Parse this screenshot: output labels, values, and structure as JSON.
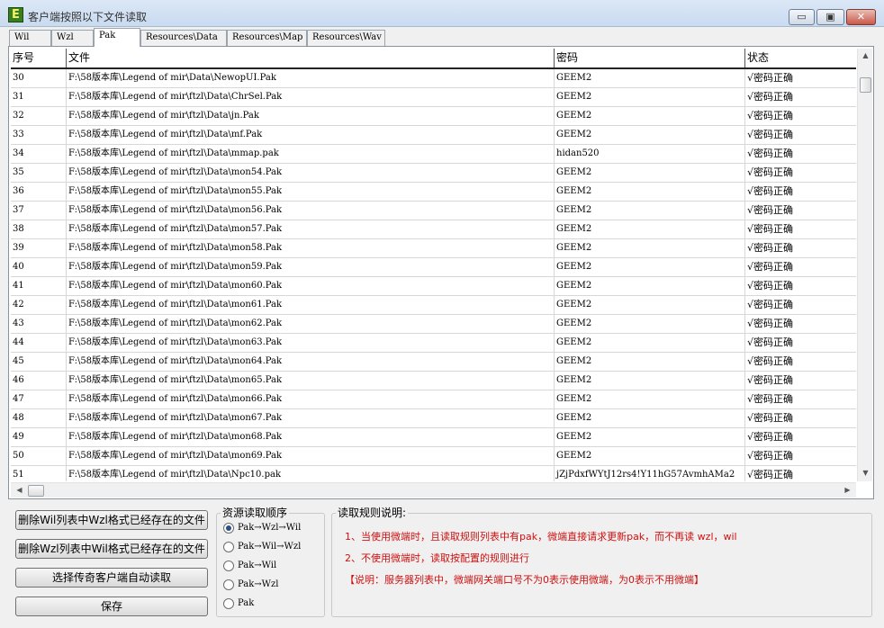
{
  "window": {
    "app_icon_letter": "E",
    "title": "客户端按照以下文件读取",
    "min_label": "▭",
    "max_label": "▣",
    "close_label": "✕"
  },
  "tabs": [
    {
      "label": "Wil",
      "active": false
    },
    {
      "label": "Wzl",
      "active": false
    },
    {
      "label": "Pak",
      "active": true
    },
    {
      "label": "Resources\\Data",
      "active": false
    },
    {
      "label": "Resources\\Map",
      "active": false
    },
    {
      "label": "Resources\\Wav",
      "active": false
    }
  ],
  "table": {
    "columns": [
      "序号",
      "文件",
      "密码",
      "状态"
    ],
    "rows": [
      {
        "no": "30",
        "file": "F:\\58版本库\\Legend of mir\\Data\\NewopUI.Pak",
        "pwd": "GEEM2",
        "status": "√密码正确"
      },
      {
        "no": "31",
        "file": "F:\\58版本库\\Legend of mir\\ftzl\\Data\\ChrSel.Pak",
        "pwd": "GEEM2",
        "status": "√密码正确"
      },
      {
        "no": "32",
        "file": "F:\\58版本库\\Legend of mir\\ftzl\\Data\\jn.Pak",
        "pwd": "GEEM2",
        "status": "√密码正确"
      },
      {
        "no": "33",
        "file": "F:\\58版本库\\Legend of mir\\ftzl\\Data\\mf.Pak",
        "pwd": "GEEM2",
        "status": "√密码正确"
      },
      {
        "no": "34",
        "file": "F:\\58版本库\\Legend of mir\\ftzl\\Data\\mmap.pak",
        "pwd": "hidan520",
        "status": "√密码正确"
      },
      {
        "no": "35",
        "file": "F:\\58版本库\\Legend of mir\\ftzl\\Data\\mon54.Pak",
        "pwd": "GEEM2",
        "status": "√密码正确"
      },
      {
        "no": "36",
        "file": "F:\\58版本库\\Legend of mir\\ftzl\\Data\\mon55.Pak",
        "pwd": "GEEM2",
        "status": "√密码正确"
      },
      {
        "no": "37",
        "file": "F:\\58版本库\\Legend of mir\\ftzl\\Data\\mon56.Pak",
        "pwd": "GEEM2",
        "status": "√密码正确"
      },
      {
        "no": "38",
        "file": "F:\\58版本库\\Legend of mir\\ftzl\\Data\\mon57.Pak",
        "pwd": "GEEM2",
        "status": "√密码正确"
      },
      {
        "no": "39",
        "file": "F:\\58版本库\\Legend of mir\\ftzl\\Data\\mon58.Pak",
        "pwd": "GEEM2",
        "status": "√密码正确"
      },
      {
        "no": "40",
        "file": "F:\\58版本库\\Legend of mir\\ftzl\\Data\\mon59.Pak",
        "pwd": "GEEM2",
        "status": "√密码正确"
      },
      {
        "no": "41",
        "file": "F:\\58版本库\\Legend of mir\\ftzl\\Data\\mon60.Pak",
        "pwd": "GEEM2",
        "status": "√密码正确"
      },
      {
        "no": "42",
        "file": "F:\\58版本库\\Legend of mir\\ftzl\\Data\\mon61.Pak",
        "pwd": "GEEM2",
        "status": "√密码正确"
      },
      {
        "no": "43",
        "file": "F:\\58版本库\\Legend of mir\\ftzl\\Data\\mon62.Pak",
        "pwd": "GEEM2",
        "status": "√密码正确"
      },
      {
        "no": "44",
        "file": "F:\\58版本库\\Legend of mir\\ftzl\\Data\\mon63.Pak",
        "pwd": "GEEM2",
        "status": "√密码正确"
      },
      {
        "no": "45",
        "file": "F:\\58版本库\\Legend of mir\\ftzl\\Data\\mon64.Pak",
        "pwd": "GEEM2",
        "status": "√密码正确"
      },
      {
        "no": "46",
        "file": "F:\\58版本库\\Legend of mir\\ftzl\\Data\\mon65.Pak",
        "pwd": "GEEM2",
        "status": "√密码正确"
      },
      {
        "no": "47",
        "file": "F:\\58版本库\\Legend of mir\\ftzl\\Data\\mon66.Pak",
        "pwd": "GEEM2",
        "status": "√密码正确"
      },
      {
        "no": "48",
        "file": "F:\\58版本库\\Legend of mir\\ftzl\\Data\\mon67.Pak",
        "pwd": "GEEM2",
        "status": "√密码正确"
      },
      {
        "no": "49",
        "file": "F:\\58版本库\\Legend of mir\\ftzl\\Data\\mon68.Pak",
        "pwd": "GEEM2",
        "status": "√密码正确"
      },
      {
        "no": "50",
        "file": "F:\\58版本库\\Legend of mir\\ftzl\\Data\\mon69.Pak",
        "pwd": "GEEM2",
        "status": "√密码正确"
      },
      {
        "no": "51",
        "file": "F:\\58版本库\\Legend of mir\\ftzl\\Data\\Npc10.pak",
        "pwd": "jZjPdxfWYtJ12rs4!Y11hG57AvmhAMa2",
        "status": "√密码正确"
      }
    ]
  },
  "buttons": {
    "delete_wil": "删除Wil列表中Wzl格式已经存在的文件",
    "delete_wzl": "删除Wzl列表中Wil格式已经存在的文件",
    "auto_read": "选择传奇客户端自动读取",
    "save": "保存"
  },
  "read_order": {
    "title": "资源读取顺序",
    "options": [
      {
        "label": "Pak→Wzl→Wil",
        "checked": true
      },
      {
        "label": "Pak→Wil→Wzl",
        "checked": false
      },
      {
        "label": "Pak→Wil",
        "checked": false
      },
      {
        "label": "Pak→Wzl",
        "checked": false
      },
      {
        "label": "Pak",
        "checked": false
      }
    ]
  },
  "rules": {
    "title": "读取规则说明:",
    "lines": [
      "1、当使用微端时，且读取规则列表中有pak，微端直接请求更新pak，而不再读 wzl，wil",
      "2、不使用微端时，读取按配置的规则进行",
      "【说明：服务器列表中，微端网关端口号不为0表示使用微端，为0表示不用微端】"
    ]
  },
  "colors": {
    "rule_text": "#d01010",
    "radio_dot": "#2a4e86"
  }
}
